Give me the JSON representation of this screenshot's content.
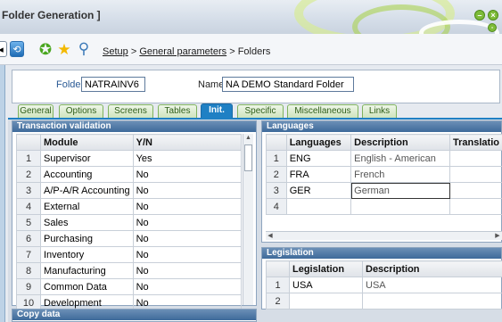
{
  "window": {
    "title": "Folder Generation ]",
    "controls": [
      "–",
      "×"
    ]
  },
  "breadcrumb": {
    "setup": "Setup",
    "sep1": ">",
    "general": "General parameters",
    "sep2": ">",
    "current": "Folders"
  },
  "header": {
    "folder_label": "Folder",
    "folder_value": "NATRAINV6",
    "name_label": "Name",
    "name_value": "NA DEMO Standard Folder"
  },
  "tabs": [
    "General",
    "Options",
    "Screens",
    "Tables",
    "Init.",
    "Specific",
    "Miscellaneous",
    "Links"
  ],
  "active_tab": "Init.",
  "transaction_validation": {
    "title": "Transaction validation",
    "columns": [
      "Module",
      "Y/N"
    ],
    "rows": [
      {
        "n": "1",
        "module": "Supervisor",
        "yn": "Yes"
      },
      {
        "n": "2",
        "module": "Accounting",
        "yn": "No"
      },
      {
        "n": "3",
        "module": "A/P-A/R Accounting",
        "yn": "No"
      },
      {
        "n": "4",
        "module": "External",
        "yn": "No"
      },
      {
        "n": "5",
        "module": "Sales",
        "yn": "No"
      },
      {
        "n": "6",
        "module": "Purchasing",
        "yn": "No"
      },
      {
        "n": "7",
        "module": "Inventory",
        "yn": "No"
      },
      {
        "n": "8",
        "module": "Manufacturing",
        "yn": "No"
      },
      {
        "n": "9",
        "module": "Common Data",
        "yn": "No"
      },
      {
        "n": "10",
        "module": "Development",
        "yn": "No"
      }
    ]
  },
  "languages": {
    "title": "Languages",
    "columns": [
      "Languages",
      "Description",
      "Translatio"
    ],
    "rows": [
      {
        "n": "1",
        "lang": "ENG",
        "desc": "English - American"
      },
      {
        "n": "2",
        "lang": "FRA",
        "desc": "French"
      },
      {
        "n": "3",
        "lang": "GER",
        "desc": "German"
      },
      {
        "n": "4",
        "lang": "",
        "desc": ""
      }
    ]
  },
  "legislation": {
    "title": "Legislation",
    "columns": [
      "Legislation",
      "Description"
    ],
    "rows": [
      {
        "n": "1",
        "leg": "USA",
        "desc": "USA"
      },
      {
        "n": "2",
        "leg": "",
        "desc": ""
      }
    ]
  },
  "copy_data": {
    "title": "Copy data"
  }
}
